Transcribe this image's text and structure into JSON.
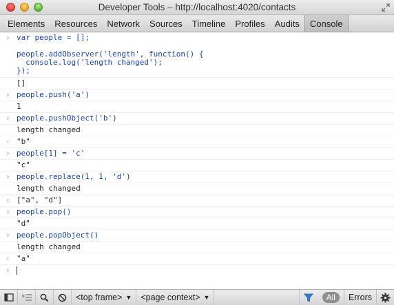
{
  "window": {
    "title": "Developer Tools – http://localhost:4020/contacts"
  },
  "tabs": [
    {
      "label": "Elements"
    },
    {
      "label": "Resources"
    },
    {
      "label": "Network"
    },
    {
      "label": "Sources"
    },
    {
      "label": "Timeline"
    },
    {
      "label": "Profiles"
    },
    {
      "label": "Audits"
    },
    {
      "label": "Console",
      "active": true
    }
  ],
  "console": {
    "entries": [
      {
        "kind": "cmd",
        "gutter": "›",
        "lines": [
          "var people = [];",
          "",
          "people.addObserver('length', function() {",
          "  console.log('length changed');",
          "});"
        ]
      },
      {
        "kind": "out",
        "gutter": "",
        "lines": [
          "[]"
        ]
      },
      {
        "kind": "cmd",
        "gutter": "›",
        "lines": [
          "people.push('a')"
        ]
      },
      {
        "kind": "num",
        "gutter": "",
        "lines": [
          "1"
        ]
      },
      {
        "kind": "cmd",
        "gutter": "›",
        "lines": [
          "people.pushObject('b')"
        ]
      },
      {
        "kind": "out",
        "gutter": "",
        "lines": [
          "length changed"
        ]
      },
      {
        "kind": "ret",
        "gutter": "‹",
        "lines": [
          "\"b\""
        ]
      },
      {
        "kind": "cmd",
        "gutter": "›",
        "lines": [
          "people[1] = 'c'"
        ]
      },
      {
        "kind": "out",
        "gutter": "",
        "lines": [
          "\"c\""
        ]
      },
      {
        "kind": "cmd",
        "gutter": "›",
        "lines": [
          "people.replace(1, 1, 'd')"
        ]
      },
      {
        "kind": "out",
        "gutter": "",
        "lines": [
          "length changed"
        ]
      },
      {
        "kind": "ret",
        "gutter": "‹",
        "lines": [
          "[\"a\", \"d\"]"
        ]
      },
      {
        "kind": "cmd",
        "gutter": "›",
        "lines": [
          "people.pop()"
        ]
      },
      {
        "kind": "out",
        "gutter": "",
        "lines": [
          "\"d\""
        ]
      },
      {
        "kind": "cmd",
        "gutter": "›",
        "lines": [
          "people.popObject()"
        ]
      },
      {
        "kind": "out",
        "gutter": "",
        "lines": [
          "length changed"
        ]
      },
      {
        "kind": "ret",
        "gutter": "‹",
        "lines": [
          "\"a\""
        ]
      }
    ],
    "prompt_gutter": "›"
  },
  "statusbar": {
    "frame_select": "<top frame>",
    "context_select": "<page context>",
    "all_label": "All",
    "errors_label": "Errors"
  },
  "icons": {
    "dock": "dock-icon",
    "execution_context": "multiline-icon",
    "search": "search-icon",
    "clear": "clear-console-icon",
    "filter": "filter-icon",
    "settings": "gear-icon"
  }
}
